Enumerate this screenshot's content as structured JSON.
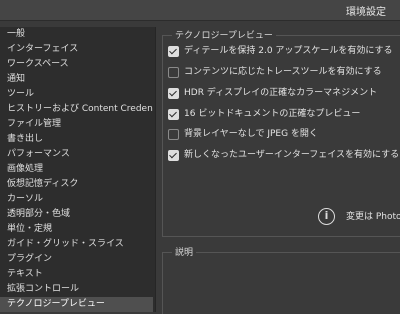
{
  "window": {
    "title": "環境設定"
  },
  "sidebar": {
    "items": [
      {
        "label": "一般"
      },
      {
        "label": "インターフェイス"
      },
      {
        "label": "ワークスペース"
      },
      {
        "label": "通知"
      },
      {
        "label": "ツール"
      },
      {
        "label": "ヒストリーおよび Content Credentials"
      },
      {
        "label": "ファイル管理"
      },
      {
        "label": "書き出し"
      },
      {
        "label": "パフォーマンス"
      },
      {
        "label": "画像処理"
      },
      {
        "label": "仮想記憶ディスク"
      },
      {
        "label": "カーソル"
      },
      {
        "label": "透明部分・色域"
      },
      {
        "label": "単位・定規"
      },
      {
        "label": "ガイド・グリッド・スライス"
      },
      {
        "label": "プラグイン"
      },
      {
        "label": "テキスト"
      },
      {
        "label": "拡張コントロール"
      },
      {
        "label": "テクノロジープレビュー"
      }
    ],
    "selected_index": 18
  },
  "tech_preview": {
    "section_title": "テクノロジープレビュー",
    "options": [
      {
        "label": "ディテールを保持 2.0 アップスケールを有効にする",
        "checked": true
      },
      {
        "label": "コンテンツに応じたトレースツールを有効にする",
        "checked": false
      },
      {
        "label": "HDR ディスプレイの正確なカラーマネジメント",
        "checked": true
      },
      {
        "label": "16 ビットドキュメントの正確なプレビュー",
        "checked": true
      },
      {
        "label": "背景レイヤーなしで JPEG を開く",
        "checked": false
      },
      {
        "label": "新しくなったユーザーインターフェイスを有効にする",
        "checked": true
      }
    ],
    "info_text": "変更は Photo"
  },
  "description": {
    "title": "説明"
  }
}
